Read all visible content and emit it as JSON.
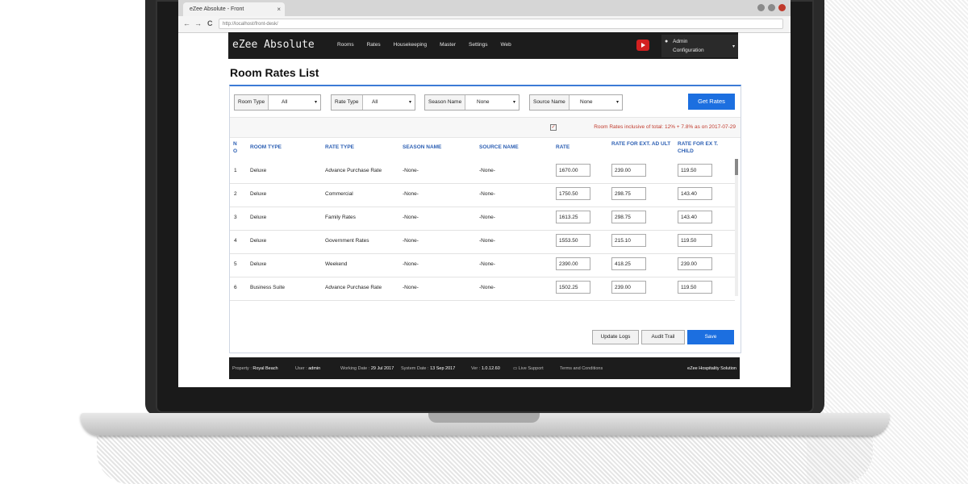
{
  "browser": {
    "tab_title": "eZee Absolute - Front",
    "address": "http://localhost/front-desk/",
    "back": "←",
    "forward": "→",
    "reload": "C"
  },
  "app": {
    "brand": "eZee Absolute",
    "menu": [
      "Rooms",
      "Rates",
      "Housekeeping",
      "Master",
      "Settings",
      "Web"
    ],
    "user_line1": "Admin",
    "user_line2": "Configuration"
  },
  "page": {
    "title": "Room Rates List"
  },
  "filters": {
    "room_type_label": "Room Type",
    "room_type_value": "All",
    "rate_type_label": "Rate Type",
    "rate_type_value": "All",
    "season_name_label": "Season Name",
    "season_name_value": "None",
    "source_name_label": "Source Name",
    "source_name_value": "None",
    "get_rates_label": "Get Rates"
  },
  "inclusive_note": "Room Rates inclusive of total: 12% + 7.8% as on 2017-07-29",
  "table": {
    "headers": [
      "N O",
      "ROOM TYPE",
      "RATE TYPE",
      "SEASON NAME",
      "SOURCE NAME",
      "RATE",
      "RATE FOR EXT. AD ULT",
      "RATE FOR EX T. CHILD"
    ],
    "rows": [
      {
        "no": "1",
        "room_type": "Deluxe",
        "rate_type": "Advance Purchase Rate",
        "season": "-None-",
        "source": "-None-",
        "rate": "1670.00",
        "ext_adult": "239.00",
        "ext_child": "119.50"
      },
      {
        "no": "2",
        "room_type": "Deluxe",
        "rate_type": "Commercial",
        "season": "-None-",
        "source": "-None-",
        "rate": "1750.50",
        "ext_adult": "298.75",
        "ext_child": "143.40"
      },
      {
        "no": "3",
        "room_type": "Deluxe",
        "rate_type": "Family Rates",
        "season": "-None-",
        "source": "-None-",
        "rate": "1613.25",
        "ext_adult": "298.75",
        "ext_child": "143.40"
      },
      {
        "no": "4",
        "room_type": "Deluxe",
        "rate_type": "Government Rates",
        "season": "-None-",
        "source": "-None-",
        "rate": "1553.50",
        "ext_adult": "215.10",
        "ext_child": "119.50"
      },
      {
        "no": "5",
        "room_type": "Deluxe",
        "rate_type": "Weekend",
        "season": "-None-",
        "source": "-None-",
        "rate": "2390.00",
        "ext_adult": "418.25",
        "ext_child": "239.00"
      },
      {
        "no": "6",
        "room_type": "Business Suite",
        "rate_type": "Advance Purchase Rate",
        "season": "-None-",
        "source": "-None-",
        "rate": "1502.25",
        "ext_adult": "239.00",
        "ext_child": "119.50"
      }
    ]
  },
  "actions": {
    "update_logs": "Update Logs",
    "audit_trail": "Audit Trail",
    "save": "Save"
  },
  "footer": {
    "property_label": "Property :",
    "property_value": "Royal Beach",
    "user_label": "User :",
    "user_value": "admin",
    "working_date_label": "Working Date :",
    "working_date_value": "29 Jul 2017",
    "system_date_label": "System Date :",
    "system_date_value": "13 Sep 2017",
    "ver_label": "Ver :",
    "ver_value": "1.0.12.60",
    "live_support": "Live Support",
    "terms": "Terms and Conditions",
    "company": "eZee Hospitality Solution"
  },
  "colors": {
    "accent": "#1c6fe0",
    "header_bg": "#1c1c1c",
    "table_header": "#2c5fb3",
    "note_red": "#c0392b"
  }
}
